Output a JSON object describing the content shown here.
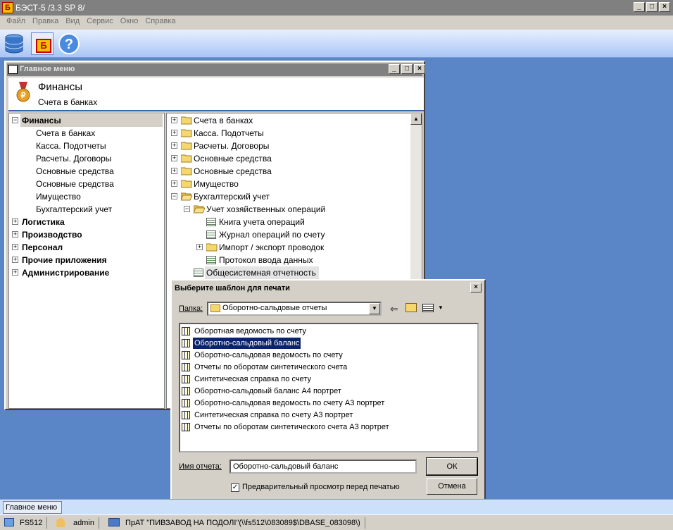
{
  "app": {
    "title": "БЭСТ-5 /3.3 SP 8/",
    "icon_letter": "Б"
  },
  "menu": [
    "Файл",
    "Правка",
    "Вид",
    "Сервис",
    "Окно",
    "Справка"
  ],
  "toolbar": [
    {
      "icon": "database-icon"
    },
    {
      "icon": "best-module-icon",
      "letter": "Б"
    },
    {
      "icon": "help-icon",
      "glyph": "?"
    }
  ],
  "child_window": {
    "title": "Главное меню",
    "header_title": "Финансы",
    "header_subtitle": "Счета в банках",
    "left_tree": [
      {
        "label": "Финансы",
        "bold": true,
        "expanded": true,
        "level": 0,
        "selected": true
      },
      {
        "label": "Счета в банках",
        "level": 1
      },
      {
        "label": "Касса. Подотчеты",
        "level": 1
      },
      {
        "label": "Расчеты. Договоры",
        "level": 1
      },
      {
        "label": "Основные средства",
        "level": 1
      },
      {
        "label": "Основные средства",
        "level": 1
      },
      {
        "label": "Имущество",
        "level": 1
      },
      {
        "label": "Бухгалтерский учет",
        "level": 1
      },
      {
        "label": "Логистика",
        "bold": true,
        "level": 0
      },
      {
        "label": "Производство",
        "bold": true,
        "level": 0
      },
      {
        "label": "Персонал",
        "bold": true,
        "level": 0
      },
      {
        "label": "Прочие приложения",
        "bold": true,
        "level": 0
      },
      {
        "label": "Администрирование",
        "bold": true,
        "level": 0
      }
    ],
    "right_tree": [
      {
        "label": "Счета в банках",
        "type": "folder",
        "level": 0,
        "toggle": "+"
      },
      {
        "label": "Касса. Подотчеты",
        "type": "folder",
        "level": 0,
        "toggle": "+"
      },
      {
        "label": "Расчеты. Договоры",
        "type": "folder",
        "level": 0,
        "toggle": "+"
      },
      {
        "label": "Основные средства",
        "type": "folder",
        "level": 0,
        "toggle": "+"
      },
      {
        "label": "Основные средства",
        "type": "folder",
        "level": 0,
        "toggle": "+"
      },
      {
        "label": "Имущество",
        "type": "folder",
        "level": 0,
        "toggle": "+"
      },
      {
        "label": "Бухгалтерский учет",
        "type": "folder-open",
        "level": 0,
        "toggle": "−"
      },
      {
        "label": "Учет хозяйственных операций",
        "type": "folder-open",
        "level": 1,
        "toggle": "−"
      },
      {
        "label": "Книга учета операций",
        "type": "report",
        "level": 2
      },
      {
        "label": "Журнал операций по счету",
        "type": "report",
        "level": 2
      },
      {
        "label": "Импорт / экспорт проводок",
        "type": "folder",
        "level": 2,
        "toggle": "+"
      },
      {
        "label": "Протокол ввода данных",
        "type": "report",
        "level": 2
      },
      {
        "label": "Общесистемная отчетность",
        "type": "report",
        "level": 1,
        "highlight": true
      }
    ]
  },
  "dialog": {
    "title": "Выберите шаблон для печати",
    "folder_label": "Папка:",
    "folder_value": "Оборотно-сальдовые отчеты",
    "templates": [
      "Оборотная ведомость по счету",
      "Оборотно-сальдовый баланс",
      "Оборотно-сальдовая ведомость по счету",
      "Отчеты по оборотам синтетического счета",
      "Синтетическая справка по счету",
      "Оборотно-сальдовый баланс А4 портрет",
      "Оборотно-сальдовая ведомость по счету А3 портрет",
      "Синтетическая справка по счету А3 портрет",
      "Отчеты по оборотам синтетического счета А3 портрет"
    ],
    "selected_index": 1,
    "name_label": "Имя отчета:",
    "name_value": "Оборотно-сальдовый баланс",
    "ok_label": "ОК",
    "cancel_label": "Отмена",
    "preview_label": "Предварительный просмотр перед печатью",
    "preview_checked": true
  },
  "taskbar": {
    "button": "Главное меню"
  },
  "status": {
    "server": "FS512",
    "user": "admin",
    "company": "ПрАТ \"ПИВЗАВОД НА ПОДОЛІ\"(\\\\fs512\\083089$\\DBASE_083098\\)"
  },
  "colors": {
    "desktop": "#5a86c8",
    "selection": "#0a246a",
    "toolbar": "#a9c5f5"
  }
}
